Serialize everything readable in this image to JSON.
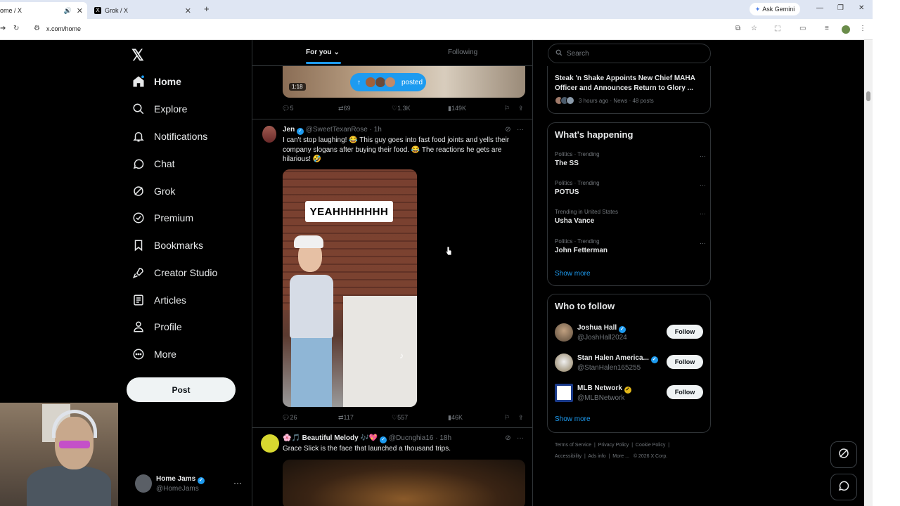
{
  "browser": {
    "tabs": [
      {
        "title": "ome / X",
        "active": true
      },
      {
        "title": "Grok / X",
        "active": false
      }
    ],
    "ask_gemini": "Ask Gemini",
    "url": "x.com/home"
  },
  "nav": {
    "items": [
      {
        "label": "Home",
        "icon": "home-icon"
      },
      {
        "label": "Explore",
        "icon": "search-icon"
      },
      {
        "label": "Notifications",
        "icon": "bell-icon"
      },
      {
        "label": "Chat",
        "icon": "chat-icon"
      },
      {
        "label": "Grok",
        "icon": "grok-icon"
      },
      {
        "label": "Premium",
        "icon": "verified-icon"
      },
      {
        "label": "Bookmarks",
        "icon": "bookmark-icon"
      },
      {
        "label": "Creator Studio",
        "icon": "rocket-icon"
      },
      {
        "label": "Articles",
        "icon": "article-icon"
      },
      {
        "label": "Profile",
        "icon": "person-icon"
      },
      {
        "label": "More",
        "icon": "more-circle-icon"
      }
    ],
    "post_label": "Post",
    "account": {
      "name": "Home Jams",
      "handle": "@HomeJams"
    }
  },
  "feed": {
    "tabs": [
      "For you",
      "Following"
    ],
    "top_post": {
      "duration": "1:18",
      "posted_label": "posted",
      "replies": "5",
      "reposts": "69",
      "likes": "1.3K",
      "views": "149K"
    },
    "posts": [
      {
        "name": "Jen",
        "handle": "@SweetTexanRose",
        "time": "1h",
        "text": "I can't stop laughing! 😂 This guy goes into fast food joints and yells their company slogans after buying their food. 😂 The reactions he gets are hilarious! 🤣",
        "video_caption": "YEAHHHHHHH",
        "replies": "26",
        "reposts": "117",
        "likes": "557",
        "views": "46K"
      },
      {
        "name": "🌸🎵 Beautiful Melody 🎶💖",
        "handle": "@Ducnghia16",
        "time": "18h",
        "text": "Grace Slick is the face that launched a thousand trips."
      }
    ]
  },
  "sidebar": {
    "search_placeholder": "Search",
    "news": {
      "title": "Steak 'n Shake Appoints New Chief MAHA Officer and Announces Return to Glory ...",
      "meta": "3 hours ago · News · 48 posts"
    },
    "happening": {
      "title": "What's happening",
      "trends": [
        {
          "context": "Politics · Trending",
          "topic": "The SS"
        },
        {
          "context": "Politics · Trending",
          "topic": "POTUS"
        },
        {
          "context": "Trending in United States",
          "topic": "Usha Vance"
        },
        {
          "context": "Politics · Trending",
          "topic": "John Fetterman"
        }
      ],
      "show_more": "Show more"
    },
    "who_to_follow": {
      "title": "Who to follow",
      "accounts": [
        {
          "name": "Joshua Hall",
          "handle": "@JoshHall2024",
          "badge": "blue"
        },
        {
          "name": "Stan Halen America...",
          "handle": "@StanHalen165255",
          "badge": "blue"
        },
        {
          "name": "MLB Network",
          "handle": "@MLBNetwork",
          "badge": "gold"
        }
      ],
      "follow_label": "Follow",
      "show_more": "Show more"
    },
    "footer": {
      "links": [
        "Terms of Service",
        "Privacy Policy",
        "Cookie Policy",
        "Accessibility",
        "Ads info",
        "More ...",
        "© 2026 X Corp."
      ]
    }
  },
  "colors": {
    "accent": "#1d9bf0",
    "background": "#000000",
    "text": "#e7e9ea",
    "muted": "#71767b",
    "border": "#2f3336"
  }
}
